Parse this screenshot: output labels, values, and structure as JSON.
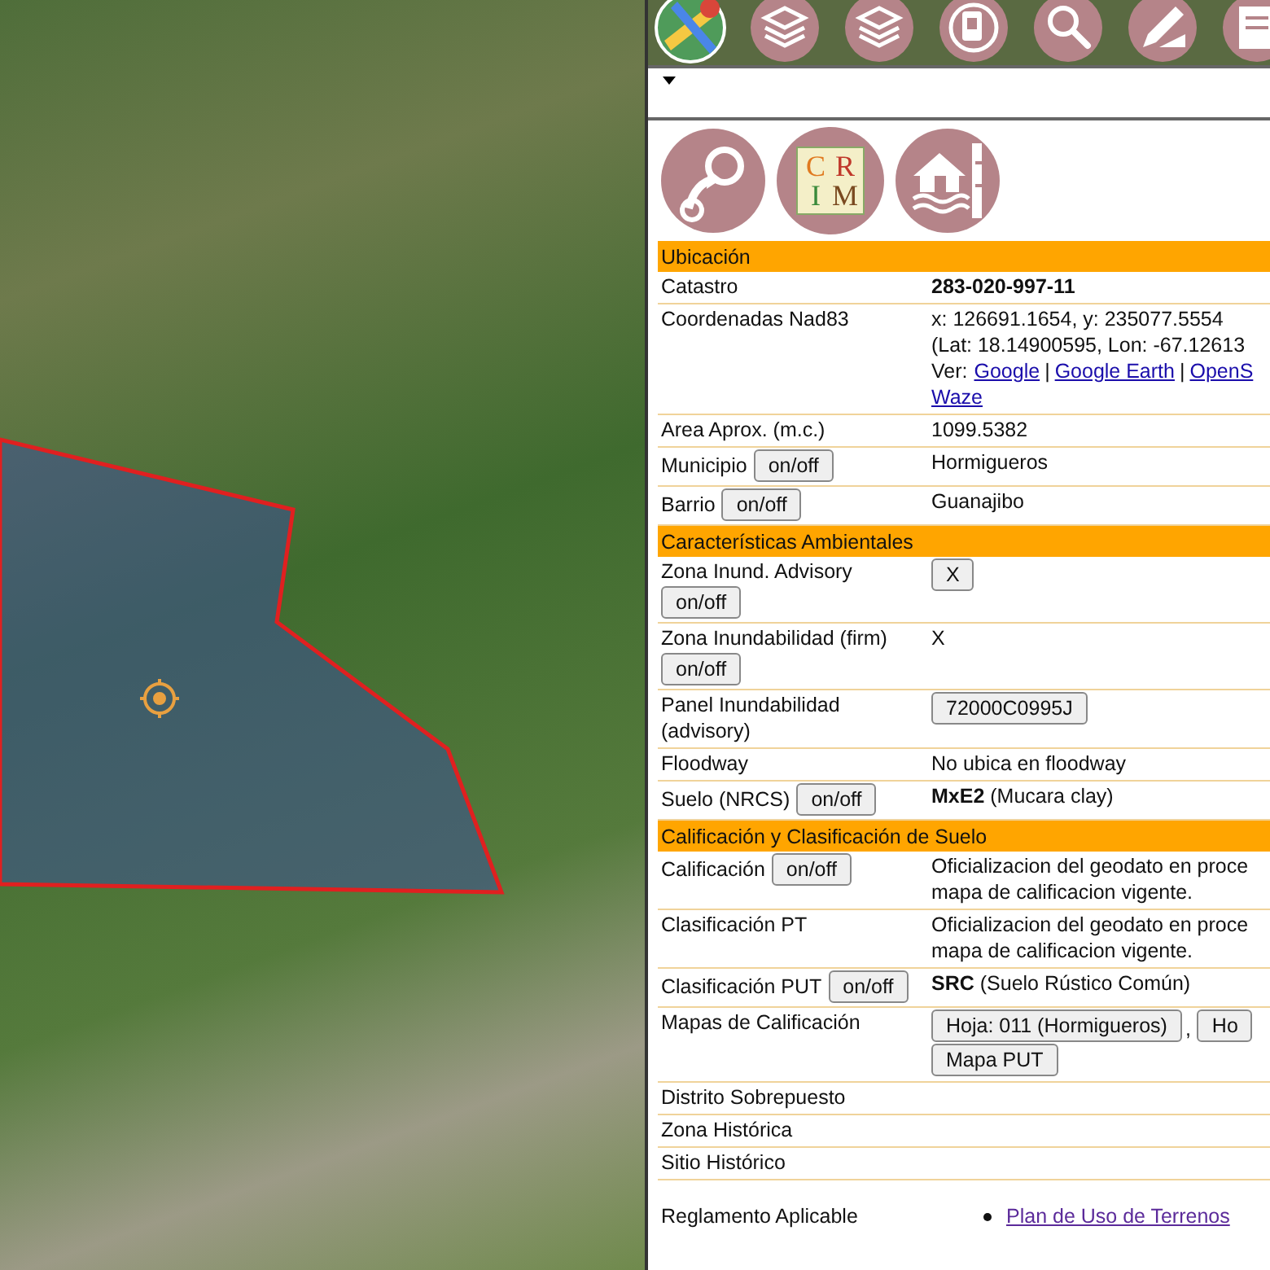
{
  "logo": {
    "letters": [
      "C",
      "R",
      "I",
      "M"
    ]
  },
  "sections": [
    {
      "title": "Ubicación",
      "rows": [
        {
          "label": "Catastro",
          "value": {
            "kind": "bold",
            "text": "283-020-997-11"
          }
        },
        {
          "label": "Coordenadas Nad83",
          "value": {
            "kind": "coords",
            "lines": [
              "x: 126691.1654, y: 235077.5554",
              "(Lat: 18.14900595, Lon: -67.12613"
            ],
            "prefix": "Ver:",
            "separator": "|",
            "link_lines": [
              [
                "Google",
                "Google Earth",
                "OpenS"
              ],
              [
                "Waze"
              ]
            ]
          }
        },
        {
          "label": "Area Aprox. (m.c.)",
          "value": {
            "kind": "text",
            "text": "1099.5382"
          }
        },
        {
          "label": "Municipio",
          "toggle": "on/off",
          "value": {
            "kind": "text",
            "text": "Hormigueros"
          }
        },
        {
          "label": "Barrio",
          "toggle": "on/off",
          "value": {
            "kind": "text",
            "text": "Guanajibo"
          }
        }
      ]
    },
    {
      "title": "Características Ambientales",
      "rows": [
        {
          "label": "Zona Inund. Advisory",
          "toggle": "on/off",
          "value": {
            "kind": "buttons",
            "button_lines": [
              [
                "X"
              ]
            ]
          }
        },
        {
          "label": "Zona Inundabilidad (firm)",
          "toggle": "on/off",
          "value": {
            "kind": "text",
            "text": "X"
          }
        },
        {
          "label": "Panel Inundabilidad (advisory)",
          "value": {
            "kind": "buttons",
            "button_lines": [
              [
                "72000C0995J"
              ]
            ]
          }
        },
        {
          "label": "Floodway",
          "value": {
            "kind": "text",
            "text": "No ubica en floodway"
          }
        },
        {
          "label": "Suelo (NRCS)",
          "toggle": "on/off",
          "value": {
            "kind": "rich",
            "text": "**MxE2** (Mucara clay)"
          }
        }
      ]
    },
    {
      "title": "Calificación y Clasificación de Suelo",
      "rows": [
        {
          "label": "Calificación",
          "toggle": "on/off",
          "value": {
            "kind": "lines",
            "lines": [
              "Oficializacion del geodato en proce",
              "mapa de calificacion vigente."
            ]
          }
        },
        {
          "label": "Clasificación PT",
          "value": {
            "kind": "lines",
            "lines": [
              "Oficializacion del geodato en proce",
              "mapa de calificacion vigente."
            ]
          }
        },
        {
          "label": "Clasificación PUT",
          "toggle": "on/off",
          "value": {
            "kind": "rich",
            "text": "**SRC** (Suelo Rústico Común)"
          }
        },
        {
          "label": "Mapas de Calificación",
          "value": {
            "kind": "buttons",
            "separator": ",",
            "button_lines": [
              [
                "Hoja: 011 (Hormigueros)",
                "Ho"
              ],
              [
                "Mapa PUT"
              ]
            ]
          }
        },
        {
          "label": "Distrito Sobrepuesto"
        },
        {
          "label": "Zona Histórica"
        },
        {
          "label": "Sitio Histórico"
        },
        {
          "label": "Reglamento Aplicable",
          "value": {
            "kind": "link_list",
            "links": [
              "Plan de Uso de Terrenos"
            ]
          }
        }
      ]
    }
  ]
}
